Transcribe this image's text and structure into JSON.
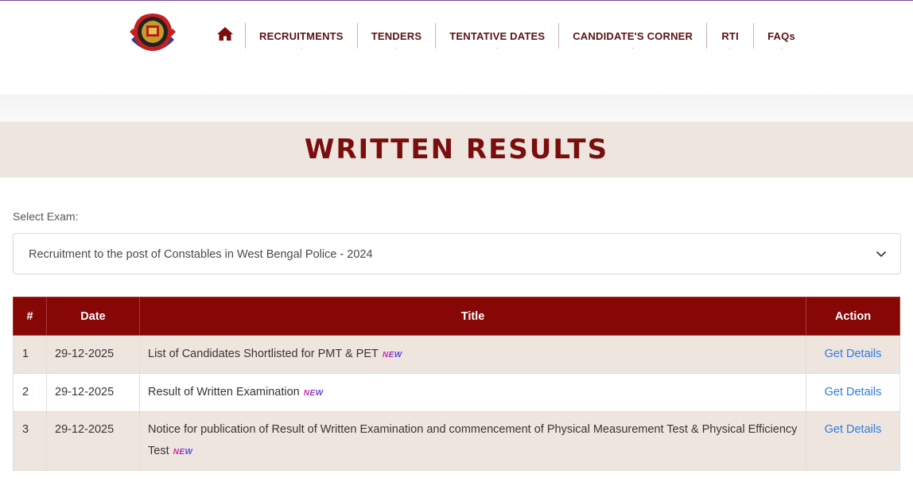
{
  "nav": {
    "items": [
      {
        "label": "RECRUITMENTS"
      },
      {
        "label": "TENDERS"
      },
      {
        "label": "TENTATIVE DATES"
      },
      {
        "label": "CANDIDATE'S CORNER"
      },
      {
        "label": "RTI"
      },
      {
        "label": "FAQs"
      }
    ]
  },
  "page_title": "WRITTEN RESULTS",
  "exam_select": {
    "label": "Select Exam:",
    "value": "Recruitment to the post of Constables in West Bengal Police - 2024"
  },
  "table": {
    "headers": [
      "#",
      "Date",
      "Title",
      "Action"
    ],
    "rows": [
      {
        "num": "1",
        "date": "29-12-2025",
        "title": "List of Candidates Shortlisted for PMT & PET",
        "badge": "NEW",
        "action": "Get Details"
      },
      {
        "num": "2",
        "date": "29-12-2025",
        "title": "Result of Written Examination",
        "badge": "NEW",
        "action": "Get Details"
      },
      {
        "num": "3",
        "date": "29-12-2025",
        "title": "Notice for publication of Result of Written Examination and commencement of Physical Measurement Test & Physical Efficiency Test",
        "badge": "NEW",
        "action": "Get Details"
      }
    ]
  },
  "colors": {
    "brand_maroon": "#870606",
    "band_beige": "#eee5df",
    "link_blue": "#2f7be0"
  }
}
